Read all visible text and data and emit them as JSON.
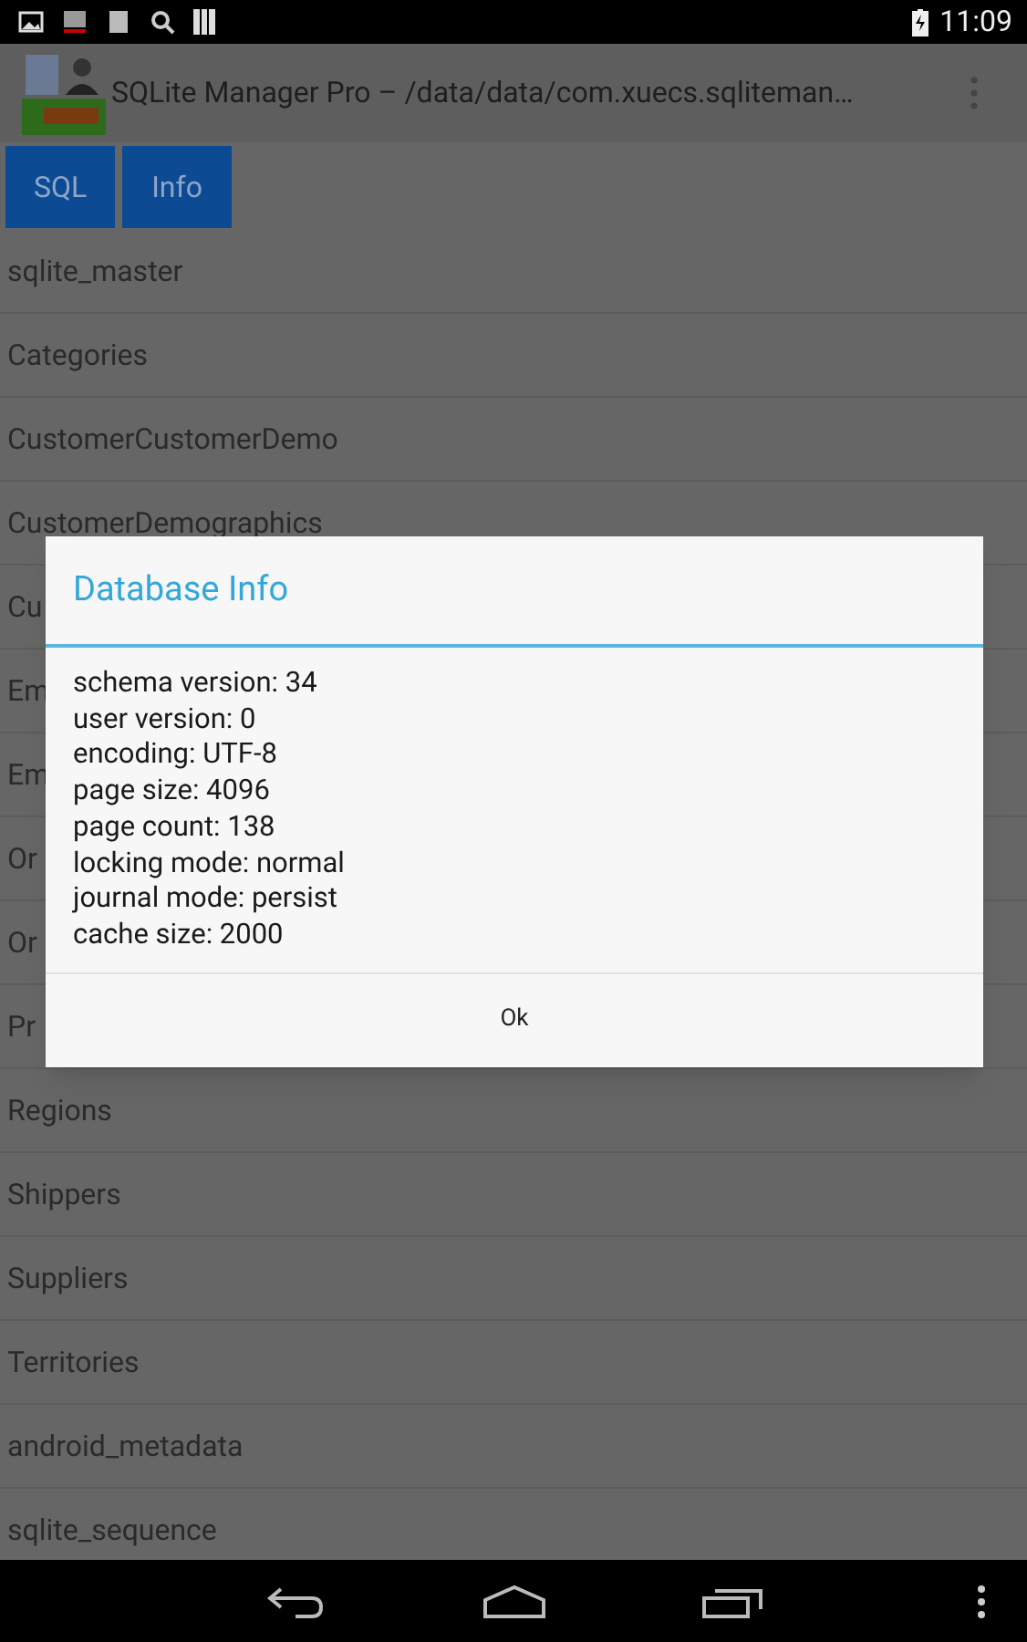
{
  "status_bar": {
    "time": "11:09"
  },
  "action_bar": {
    "title": "SQLite Manager Pro – /data/data/com.xuecs.sqliteman…"
  },
  "buttons": [
    {
      "label": "SQL"
    },
    {
      "label": "Info"
    }
  ],
  "tables": [
    "sqlite_master",
    "Categories",
    "CustomerCustomerDemo",
    "CustomerDemographics",
    "Cu",
    "Em",
    "Em",
    "Or",
    "Or",
    "Pr",
    "Regions",
    "Shippers",
    "Suppliers",
    "Territories",
    "android_metadata",
    "sqlite_sequence"
  ],
  "dialog": {
    "title": "Database Info",
    "lines": [
      "schema version: 34",
      "user version: 0",
      "encoding: UTF-8",
      "page size: 4096",
      "page count: 138",
      "locking mode: normal",
      "journal mode: persist",
      "cache size: 2000"
    ],
    "button": "Ok"
  }
}
